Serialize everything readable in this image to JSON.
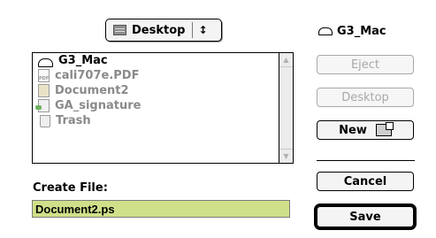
{
  "location_popup": {
    "label": "Desktop",
    "icon": "folder-icon",
    "arrows": "↕"
  },
  "volume": {
    "name": "G3_Mac",
    "icon": "hard-disk-icon"
  },
  "file_list": {
    "items": [
      {
        "name": "G3_Mac",
        "icon": "hard-disk-icon",
        "enabled": true
      },
      {
        "name": "cali707e.PDF",
        "icon": "pdf-file-icon",
        "enabled": false
      },
      {
        "name": "Document2",
        "icon": "document-icon",
        "enabled": false
      },
      {
        "name": "GA_signature",
        "icon": "alias-file-icon",
        "enabled": false
      },
      {
        "name": "Trash",
        "icon": "trash-icon",
        "enabled": false
      }
    ]
  },
  "buttons": {
    "eject": "Eject",
    "desktop": "Desktop",
    "new": "New",
    "cancel": "Cancel",
    "save": "Save"
  },
  "create_file": {
    "label": "Create File:",
    "value": "Document2.ps"
  },
  "colors": {
    "filename_highlight": "#cfe08a"
  }
}
